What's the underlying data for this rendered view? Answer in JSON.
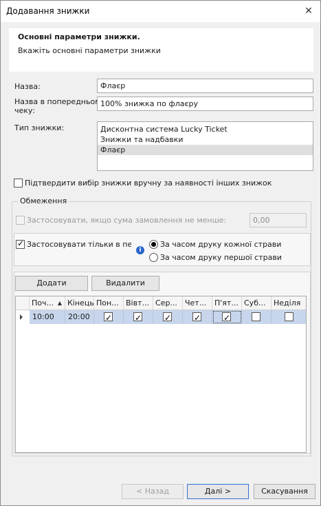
{
  "window": {
    "title": "Додавання знижки",
    "close_glyph": "✕"
  },
  "header": {
    "title": "Основні параметри знижки.",
    "subtitle": "Вкажіть основні параметри знижки"
  },
  "form": {
    "name_label": "Назва:",
    "name_value": "Флаєр",
    "receipt_label_line1": "Назва в попередньому",
    "receipt_label_line2": "чеку:",
    "receipt_value": "100% знижка по флаєру",
    "type_label": "Тип знижки:",
    "type_options": [
      "Дисконтна система Lucky Ticket",
      "Знижки та надбавки",
      "Флаєр"
    ],
    "type_selected_index": 2,
    "confirm_manual_label": "Підтвердити вибір знижки вручну за наявності інших знижок",
    "confirm_manual_checked": false
  },
  "restrictions": {
    "group_label": "Обмеження",
    "min_sum_label": "Застосовувати, якщо сума замовлення не менше:",
    "min_sum_checked": false,
    "min_sum_value": "0,00",
    "period_label": "Застосовувати тільки в період",
    "period_checked": true,
    "info_glyph": "i",
    "radio_each": "За часом друку кожної страви",
    "radio_first": "За часом друку першої страви",
    "radio_selected": "each",
    "add_button": "Додати",
    "delete_button": "Видалити",
    "grid": {
      "columns": [
        "Поч...",
        "Кінець",
        "Пон...",
        "Вівт...",
        "Сер...",
        "Чет...",
        "П'ят...",
        "Суб...",
        "Неділя"
      ],
      "sort_arrow": "▲",
      "rows": [
        {
          "start": "10:00",
          "end": "20:00",
          "days": [
            true,
            true,
            true,
            true,
            true,
            false,
            false
          ]
        }
      ]
    }
  },
  "footer": {
    "back_button": "< Назад",
    "next_button": "Далі >",
    "cancel_button": "Скасування"
  }
}
